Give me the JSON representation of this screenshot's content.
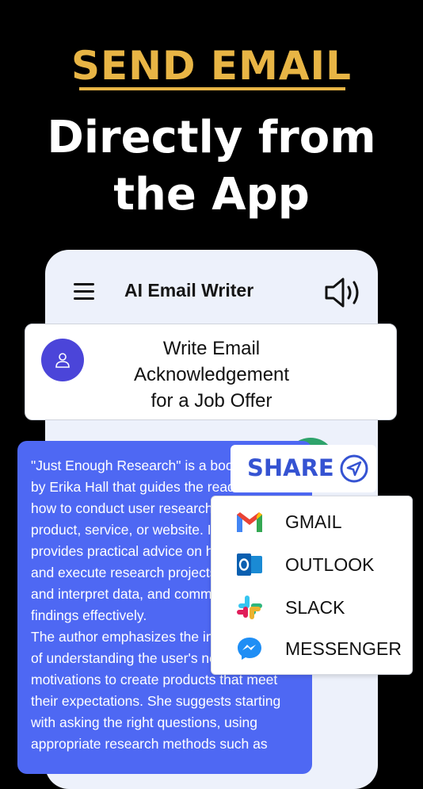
{
  "promo": {
    "headline": "SEND EMAIL",
    "subheadline_line1": "Directly from",
    "subheadline_line2": "the App"
  },
  "appbar": {
    "title": "AI Email Writer",
    "menu_icon": "hamburger-menu-icon",
    "speaker_icon": "speaker-icon"
  },
  "prompt": {
    "line1": "Write Email",
    "line2": "Acknowledgement",
    "line3": "for a Job Offer"
  },
  "response": {
    "text": "\"Just Enough Research\" is a book\nby Erika Hall that guides the readers on\nhow to conduct user research for a\nproduct, service, or website. It\nprovides practical advice on how to plan\nand execute research projects, gather\nand interpret data, and communicate\nfindings effectively.\nThe author emphasizes the importance\nof understanding the user's needs and\nmotivations to create products that meet\ntheir expectations. She suggests starting\nwith asking the right questions, using\nappropriate research methods such as"
  },
  "share": {
    "label": "SHARE",
    "items": [
      {
        "label": "GMAIL",
        "icon": "gmail-icon"
      },
      {
        "label": "OUTLOOK",
        "icon": "outlook-icon"
      },
      {
        "label": "SLACK",
        "icon": "slack-icon"
      },
      {
        "label": "MESSENGER",
        "icon": "messenger-icon"
      }
    ]
  },
  "colors": {
    "background": "#000000",
    "headline": "#e8b545",
    "accent_blue": "#4e68f3",
    "avatar": "#4b45d9",
    "share_text": "#3553d2"
  }
}
